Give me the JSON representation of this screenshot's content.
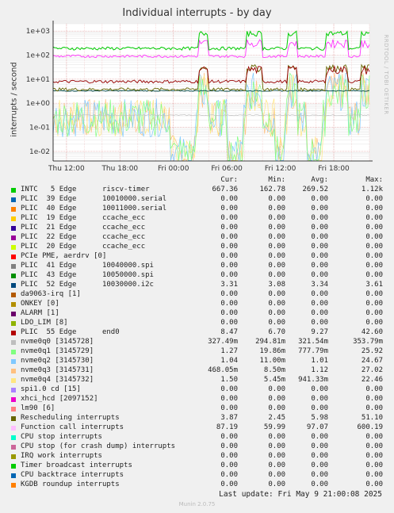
{
  "chart_data": {
    "type": "line",
    "title": "Individual interrupts - by day",
    "ylabel": "interrupts / second",
    "yscale": "log",
    "ylim": [
      0.004,
      2000
    ],
    "yticks": [
      {
        "value": 1000,
        "label": "1e+03"
      },
      {
        "value": 100,
        "label": "1e+02"
      },
      {
        "value": 10,
        "label": "1e+01"
      },
      {
        "value": 1,
        "label": "1e+00"
      },
      {
        "value": 0.1,
        "label": "1e-01"
      },
      {
        "value": 0.01,
        "label": "1e-02"
      }
    ],
    "x_start": "Thu 10:30",
    "x_end": "Fri 22:00",
    "xticks": [
      "Thu 12:00",
      "Thu 18:00",
      "Fri 00:00",
      "Fri 06:00",
      "Fri 12:00",
      "Fri 18:00"
    ],
    "grid": true,
    "colors": {
      "intc_riscv_timer": "#00cc00",
      "serial_high": "#ff00ff",
      "sch_ccache": "#ff8a8a",
      "sch_rescheduling": "#4d6b00",
      "sch_plic55": "#990000",
      "sch_i2c": "#004a4a",
      "nvme": "#ff9900"
    },
    "columns": [
      "Cur:",
      "Min:",
      "Avg:",
      "Max:"
    ],
    "series": [
      {
        "name": "INTC   5 Edge      riscv-timer",
        "color": "#00cc00",
        "cur": "667.36",
        "min": "162.78",
        "avg": "269.52",
        "max": "1.12k"
      },
      {
        "name": "PLIC  39 Edge      10010000.serial",
        "color": "#0066b3",
        "cur": "0.00",
        "min": "0.00",
        "avg": "0.00",
        "max": "0.00"
      },
      {
        "name": "PLIC  40 Edge      10011000.serial",
        "color": "#ff8000",
        "cur": "0.00",
        "min": "0.00",
        "avg": "0.00",
        "max": "0.00"
      },
      {
        "name": "PLIC  19 Edge      ccache_ecc",
        "color": "#ffcc00",
        "cur": "0.00",
        "min": "0.00",
        "avg": "0.00",
        "max": "0.00"
      },
      {
        "name": "PLIC  21 Edge      ccache_ecc",
        "color": "#330099",
        "cur": "0.00",
        "min": "0.00",
        "avg": "0.00",
        "max": "0.00"
      },
      {
        "name": "PLIC  22 Edge      ccache_ecc",
        "color": "#990099",
        "cur": "0.00",
        "min": "0.00",
        "avg": "0.00",
        "max": "0.00"
      },
      {
        "name": "PLIC  20 Edge      ccache_ecc",
        "color": "#ccff00",
        "cur": "0.00",
        "min": "0.00",
        "avg": "0.00",
        "max": "0.00"
      },
      {
        "name": "PCIe PME, aerdrv [0]",
        "color": "#ff0000",
        "cur": "0.00",
        "min": "0.00",
        "avg": "0.00",
        "max": "0.00"
      },
      {
        "name": "PLIC  41 Edge      10040000.spi",
        "color": "#808080",
        "cur": "0.00",
        "min": "0.00",
        "avg": "0.00",
        "max": "0.00"
      },
      {
        "name": "PLIC  43 Edge      10050000.spi",
        "color": "#008f00",
        "cur": "0.00",
        "min": "0.00",
        "avg": "0.00",
        "max": "0.00"
      },
      {
        "name": "PLIC  52 Edge      10030000.i2c",
        "color": "#00487d",
        "cur": "3.31",
        "min": "3.08",
        "avg": "3.34",
        "max": "3.61"
      },
      {
        "name": "da9063-irq [1]",
        "color": "#b35a00",
        "cur": "0.00",
        "min": "0.00",
        "avg": "0.00",
        "max": "0.00"
      },
      {
        "name": "ONKEY [0]",
        "color": "#b38f00",
        "cur": "0.00",
        "min": "0.00",
        "avg": "0.00",
        "max": "0.00"
      },
      {
        "name": "ALARM [1]",
        "color": "#6b006b",
        "cur": "0.00",
        "min": "0.00",
        "avg": "0.00",
        "max": "0.00"
      },
      {
        "name": "LDO_LIM [8]",
        "color": "#8fb300",
        "cur": "0.00",
        "min": "0.00",
        "avg": "0.00",
        "max": "0.00"
      },
      {
        "name": "PLIC  55 Edge      end0",
        "color": "#b30000",
        "cur": "8.47",
        "min": "6.70",
        "avg": "9.27",
        "max": "42.60"
      },
      {
        "name": "nvme0q0 [3145728]",
        "color": "#bebebe",
        "cur": "327.49m",
        "min": "294.81m",
        "avg": "321.54m",
        "max": "353.79m"
      },
      {
        "name": "nvme0q1 [3145729]",
        "color": "#80ff80",
        "cur": "1.27",
        "min": "19.86m",
        "avg": "777.79m",
        "max": "25.92"
      },
      {
        "name": "nvme0q2 [3145730]",
        "color": "#80c9ff",
        "cur": "1.04",
        "min": "11.00m",
        "avg": "1.01",
        "max": "24.67"
      },
      {
        "name": "nvme0q3 [3145731]",
        "color": "#ffc080",
        "cur": "468.05m",
        "min": "8.50m",
        "avg": "1.12",
        "max": "27.02"
      },
      {
        "name": "nvme0q4 [3145732]",
        "color": "#ffe680",
        "cur": "1.50",
        "min": "5.45m",
        "avg": "941.33m",
        "max": "22.46"
      },
      {
        "name": "spi1.0 cd [15]",
        "color": "#aa80ff",
        "cur": "0.00",
        "min": "0.00",
        "avg": "0.00",
        "max": "0.00"
      },
      {
        "name": "xhci_hcd [2097152]",
        "color": "#ee00cc",
        "cur": "0.00",
        "min": "0.00",
        "avg": "0.00",
        "max": "0.00"
      },
      {
        "name": "lm90 [6]",
        "color": "#ff8080",
        "cur": "0.00",
        "min": "0.00",
        "avg": "0.00",
        "max": "0.00"
      },
      {
        "name": "Rescheduling interrupts",
        "color": "#666600",
        "cur": "3.87",
        "min": "2.45",
        "avg": "5.98",
        "max": "51.10"
      },
      {
        "name": "Function call interrupts",
        "color": "#ffbfff",
        "cur": "87.19",
        "min": "59.99",
        "avg": "97.07",
        "max": "600.19"
      },
      {
        "name": "CPU stop interrupts",
        "color": "#00ffcc",
        "cur": "0.00",
        "min": "0.00",
        "avg": "0.00",
        "max": "0.00"
      },
      {
        "name": "CPU stop (for crash dump) interrupts",
        "color": "#cc6699",
        "cur": "0.00",
        "min": "0.00",
        "avg": "0.00",
        "max": "0.00"
      },
      {
        "name": "IRQ work interrupts",
        "color": "#999900",
        "cur": "0.00",
        "min": "0.00",
        "avg": "0.00",
        "max": "0.00"
      },
      {
        "name": "Timer broadcast interrupts",
        "color": "#00cc00",
        "cur": "0.00",
        "min": "0.00",
        "avg": "0.00",
        "max": "0.00"
      },
      {
        "name": "CPU backtrace interrupts",
        "color": "#0066b3",
        "cur": "0.00",
        "min": "0.00",
        "avg": "0.00",
        "max": "0.00"
      },
      {
        "name": "KGDB roundup interrupts",
        "color": "#ff8000",
        "cur": "0.00",
        "min": "0.00",
        "avg": "0.00",
        "max": "0.00"
      }
    ]
  },
  "side_label": "RRDTOOL / TOBI OETIKER",
  "last_update": "Last update: Fri May  9 21:00:08 2025",
  "footer": "Munin 2.0.75"
}
